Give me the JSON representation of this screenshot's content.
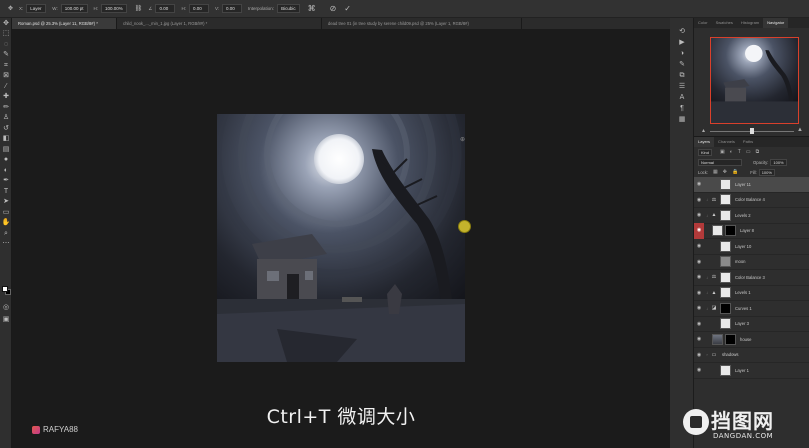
{
  "options_bar": {
    "x_label": "X:",
    "x_value": "Layer",
    "w_label": "W:",
    "w_value": "100.00 pt",
    "h_label": "H:",
    "h_value": "100.00%",
    "angle_value": "0.00",
    "h_skew": "0.00",
    "v_skew": "0.00",
    "interp_label": "Interpolation:",
    "interp_value": "Bicubic",
    "commit_icon": "check-icon",
    "cancel_icon": "cancel-icon"
  },
  "tabs": [
    {
      "label": "Roman.psd @ 25.3% (Layer 11, RGB/8#) *",
      "active": true
    },
    {
      "label": "child_nook_..._min_1.jpg (Layer 1, RGB/8#) *",
      "active": false
    },
    {
      "label": "dead tree 01 (in tree study by serene child09.psd @ 25% (Layer 1, RGB/8#)",
      "active": false
    }
  ],
  "caption": "Ctrl+T 微调大小",
  "watermark_handle": "RAFYA88",
  "site_watermark": {
    "big": "挡图网",
    "small": "DANGDAN.COM"
  },
  "navigator": {
    "tabs": [
      "Color",
      "Swatches",
      "Histogram",
      "Navigator"
    ],
    "active": "Navigator"
  },
  "layers_panel": {
    "tabs": [
      "Layers",
      "Channels",
      "Paths"
    ],
    "active": "Layers",
    "search_label": "Kind",
    "blend_mode": "Normal",
    "opacity_label": "Opacity:",
    "opacity": "100%",
    "lock_label": "Lock:",
    "fill_label": "Fill:",
    "fill": "100%",
    "layers": [
      {
        "name": "Layer 11",
        "thumb": "white",
        "selected": true,
        "adj": "",
        "mask": false
      },
      {
        "name": "Color Balance 4",
        "thumb": "white",
        "adj": "⚖",
        "mask": true
      },
      {
        "name": "Levels 2",
        "thumb": "white",
        "adj": "▲",
        "mask": true
      },
      {
        "name": "Layer 8",
        "thumb": "white",
        "adj": "",
        "mask": true,
        "mask_black": true,
        "red_eye": true
      },
      {
        "name": "Layer 10",
        "thumb": "white",
        "adj": "",
        "mask": false
      },
      {
        "name": "moon",
        "thumb": "gray",
        "adj": "",
        "mask": false
      },
      {
        "name": "Color Balance 3",
        "thumb": "white",
        "adj": "⚖",
        "mask": true
      },
      {
        "name": "Levels 1",
        "thumb": "white",
        "adj": "▲",
        "mask": true
      },
      {
        "name": "Curves 1",
        "thumb": "white",
        "adj": "◪",
        "mask": true,
        "mask_black": true
      },
      {
        "name": "Layer 3",
        "thumb": "white",
        "adj": "",
        "mask": false
      },
      {
        "name": "house",
        "thumb": "photo",
        "adj": "",
        "mask": true,
        "mask_black": true
      },
      {
        "name": "shadows",
        "thumb": "folder",
        "adj": "",
        "mask": false
      },
      {
        "name": "Layer 1",
        "thumb": "white",
        "adj": "",
        "mask": false
      }
    ]
  },
  "colors": {
    "accent_red": "#d9402b",
    "handle_yellow": "#c4b32c"
  }
}
